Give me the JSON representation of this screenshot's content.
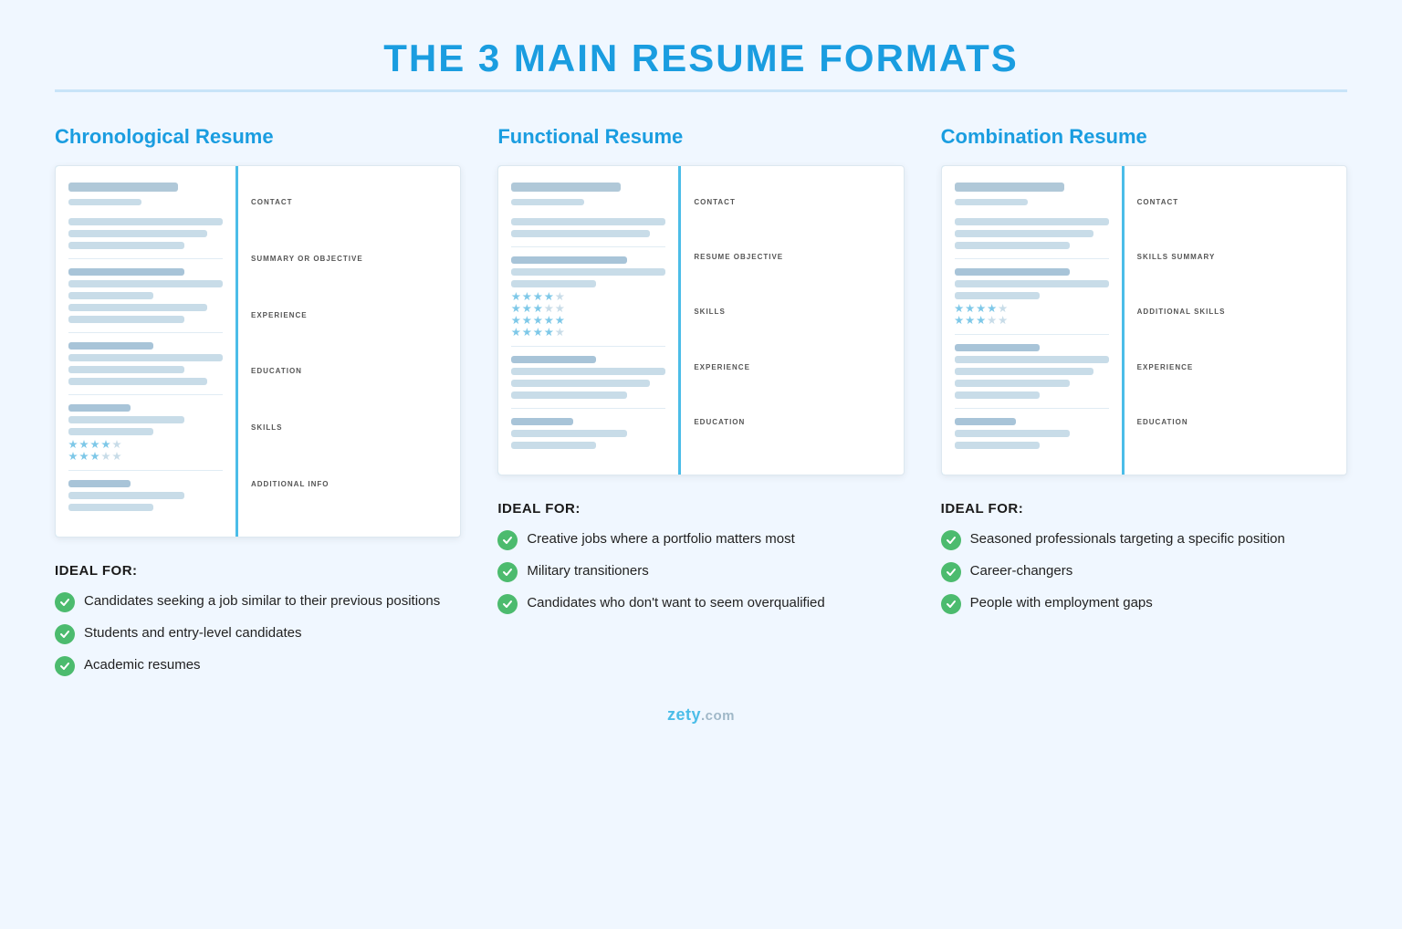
{
  "page": {
    "title": "THE 3 MAIN RESUME FORMATS"
  },
  "columns": [
    {
      "id": "chronological",
      "title": "Chronological Resume",
      "resume_sections": [
        "CONTACT",
        "SUMMARY OR OBJECTIVE",
        "EXPERIENCE",
        "EDUCATION",
        "SKILLS",
        "ADDITIONAL INFO"
      ],
      "ideal_for_title": "IDEAL FOR:",
      "ideal_items": [
        "Candidates seeking a job similar to their previous positions",
        "Students and entry-level candidates",
        "Academic resumes"
      ]
    },
    {
      "id": "functional",
      "title": "Functional Resume",
      "resume_sections": [
        "CONTACT",
        "RESUME OBJECTIVE",
        "SKILLS",
        "EXPERIENCE",
        "EDUCATION"
      ],
      "ideal_for_title": "IDEAL FOR:",
      "ideal_items": [
        "Creative jobs where a portfolio matters most",
        "Military transitioners",
        "Candidates who don't want to seem overqualified"
      ]
    },
    {
      "id": "combination",
      "title": "Combination Resume",
      "resume_sections": [
        "CONTACT",
        "SKILLS SUMMARY",
        "ADDITIONAL SKILLS",
        "EXPERIENCE",
        "EDUCATION"
      ],
      "ideal_for_title": "IDEAL FOR:",
      "ideal_items": [
        "Seasoned professionals targeting a specific position",
        "Career-changers",
        "People with employment gaps"
      ]
    }
  ],
  "footer": {
    "brand": "zety",
    "tld": ".com"
  }
}
